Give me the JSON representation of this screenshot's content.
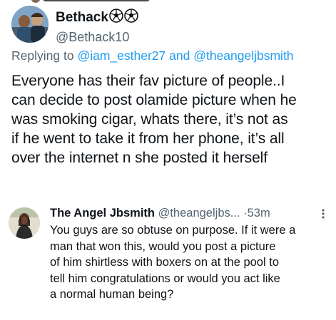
{
  "main_tweet": {
    "display_name": "Bethack",
    "name_emoji": "soccer-ball-icon x2",
    "handle": "@Bethack10",
    "replying_label": "Replying to",
    "replying_to": [
      "@iam_esther27",
      "@theangeljbsmith"
    ],
    "replying_joiner": "and",
    "text": "Everyone has their fav picture of people..I\ncan decide to post olamide picture when he\nwas smoking cigar, whats there, it’s not as\nif he went to take it from her phone, it’s all\nover the internet n she posted it herself"
  },
  "reply_tweet": {
    "display_name": "The Angel Jbsmith",
    "handle": "@theangeljbs...",
    "separator": "·",
    "time": "53m",
    "text": "You guys are so obtuse on purpose. If it were a\nman that won this, would you post a picture\nof him shirtless with boxers on at the pool to\ntell him congratulations or would you act like\na normal human being?"
  },
  "colors": {
    "text": "#0f1419",
    "secondary": "#536471",
    "link": "#1d9bf0",
    "background": "#ffffff"
  }
}
